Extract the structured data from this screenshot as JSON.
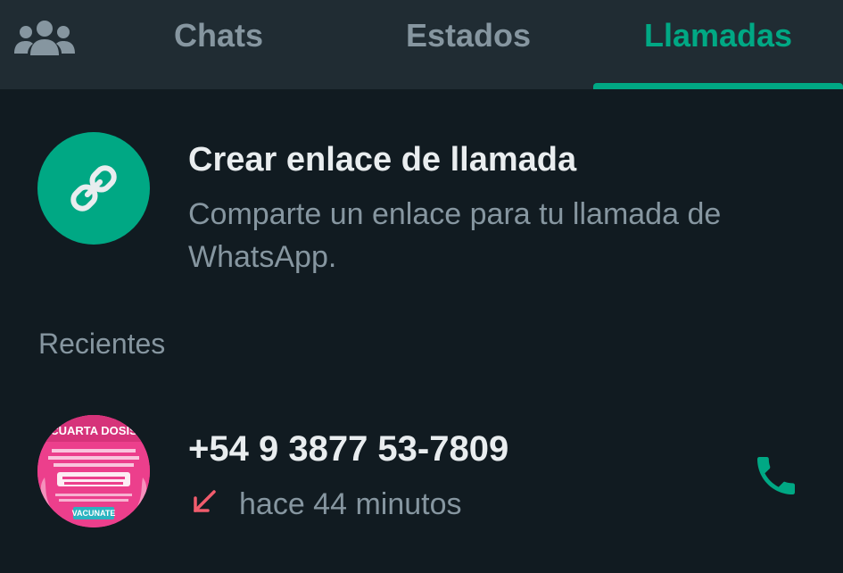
{
  "colors": {
    "accent": "#00a884",
    "background": "#111b21",
    "header": "#202c33",
    "text_primary": "#e9edef",
    "text_secondary": "#8696a0",
    "missed_call": "#f15c6d"
  },
  "header": {
    "community_icon": "community-icon",
    "tabs": [
      {
        "label": "Chats",
        "active": false
      },
      {
        "label": "Estados",
        "active": false
      },
      {
        "label": "Llamadas",
        "active": true
      }
    ]
  },
  "call_link": {
    "icon": "link-icon",
    "title": "Crear enlace de llamada",
    "subtitle": "Comparte un enlace para tu llamada de WhatsApp."
  },
  "recents": {
    "label": "Recientes",
    "calls": [
      {
        "contact": "+54 9 3877 53-7809",
        "direction_icon": "missed-call-arrow-icon",
        "time": "hace 44 minutos",
        "action_icon": "phone-icon",
        "avatar": {
          "heading": "CUARTA DOSIS",
          "badge": "VACUNATE"
        }
      }
    ]
  }
}
